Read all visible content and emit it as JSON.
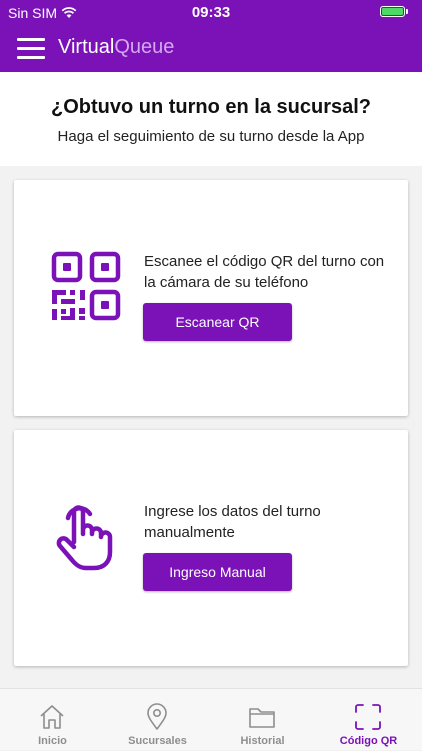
{
  "status_bar": {
    "carrier": "Sin SIM",
    "time": "09:33",
    "battery_level": 1.0,
    "battery_color": "#4cd964"
  },
  "app_bar": {
    "title_bold": "Virtual",
    "title_light": "Queue",
    "menu_icon": "hamburger-menu-icon",
    "background_color": "#7b12b8"
  },
  "intro": {
    "title": "¿Obtuvo un turno en la sucursal?",
    "subtitle": "Haga el seguimiento de su turno desde la App"
  },
  "cards": {
    "qr": {
      "icon": "qr-code-icon",
      "description": "Escanee el código QR del turno con la cámara de su teléfono",
      "button_label": "Escanear QR"
    },
    "manual": {
      "icon": "touch-hand-icon",
      "description": "Ingrese los datos del turno manualmente",
      "button_label": "Ingreso Manual"
    }
  },
  "tab_bar": {
    "active_color": "#7b12b8",
    "tabs": [
      {
        "label": "Inicio",
        "icon": "home-icon",
        "active": false
      },
      {
        "label": "Sucursales",
        "icon": "map-pin-icon",
        "active": false
      },
      {
        "label": "Historial",
        "icon": "folder-icon",
        "active": false
      },
      {
        "label": "Código QR",
        "icon": "scan-frame-icon",
        "active": true
      }
    ]
  }
}
